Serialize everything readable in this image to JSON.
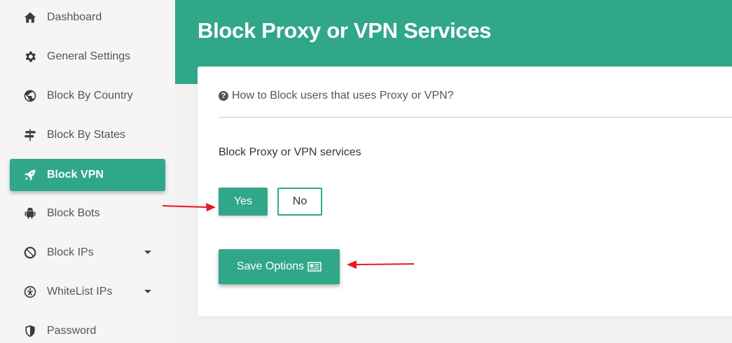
{
  "sidebar": {
    "items": [
      {
        "label": "Dashboard",
        "icon": "home-icon"
      },
      {
        "label": "General Settings",
        "icon": "gear-icon"
      },
      {
        "label": "Block By Country",
        "icon": "globe-icon"
      },
      {
        "label": "Block By States",
        "icon": "signpost-icon"
      },
      {
        "label": "Block VPN",
        "icon": "rocket-icon",
        "active": true
      },
      {
        "label": "Block Bots",
        "icon": "android-icon"
      },
      {
        "label": "Block IPs",
        "icon": "ban-icon",
        "has_caret": true
      },
      {
        "label": "WhiteList IPs",
        "icon": "accessibility-icon",
        "has_caret": true
      },
      {
        "label": "Password",
        "icon": "shield-icon"
      }
    ]
  },
  "main": {
    "title": "Block Proxy or VPN Services",
    "help_text": "How to Block users that uses Proxy or VPN?",
    "field_label": "Block Proxy or VPN services",
    "yes_label": "Yes",
    "no_label": "No",
    "selected": "Yes",
    "save_label": "Save Options"
  },
  "colors": {
    "accent": "#30a789",
    "annotation_arrow": "#e8191e"
  }
}
